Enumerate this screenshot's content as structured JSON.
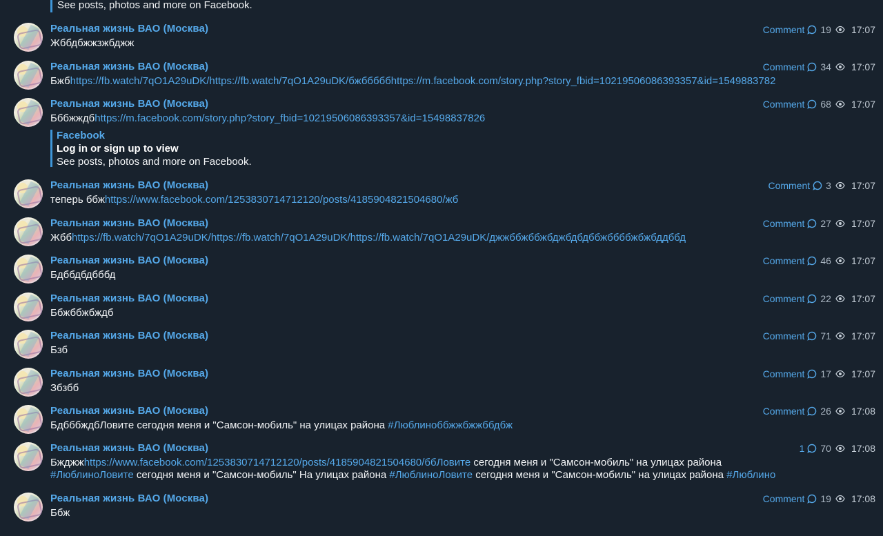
{
  "top_quote": {
    "body": "See posts, photos and more on Facebook."
  },
  "channel_name": "Реальная жизнь ВАО (Москва)",
  "messages": [
    {
      "comment": "Comment",
      "views": "19",
      "time": "17:07",
      "text": "Жббдбжжзжбджж"
    },
    {
      "comment": "Comment",
      "views": "34",
      "time": "17:07",
      "text": "Бжб",
      "link": "https://fb.watch/7qO1A29uDK/https://fb.watch/7qO1A29uDK/бжбббббhttps://m.facebook.com/story.php?story_fbid=10219506086393357&id=1549883782"
    },
    {
      "comment": "Comment",
      "views": "68",
      "time": "17:07",
      "text": "Ббб​жждб",
      "link": "https://m.facebook.com/story.php?story_fbid=10219506086393357&id=15498837826",
      "preview": {
        "site": "Facebook",
        "title": "Log in or sign up to view",
        "body": "See posts, photos and more on Facebook."
      }
    },
    {
      "comment": "Comment",
      "views": "3",
      "time": "17:07",
      "text": "теперь ббж",
      "link": "https://www.facebook.com/1253830714712120/posts/4185904821504680/жб"
    },
    {
      "comment": "Comment",
      "views": "27",
      "time": "17:07",
      "text": "Жбб",
      "link": "https://fb.watch/7qO1A29uDK/https://fb.watch/7qO1A29uDK/https://fb.watch/7qO1A29uDK/джжббжббжбджбдбдббжббббжбжбддббд"
    },
    {
      "comment": "Comment",
      "views": "46",
      "time": "17:07",
      "text": "Бдббдбдбббд"
    },
    {
      "comment": "Comment",
      "views": "22",
      "time": "17:07",
      "text": "Ббжббжбждб"
    },
    {
      "comment": "Comment",
      "views": "71",
      "time": "17:07",
      "text": "Бзб"
    },
    {
      "comment": "Comment",
      "views": "17",
      "time": "17:07",
      "text": "Збзбб"
    },
    {
      "comment": "Comment",
      "views": "26",
      "time": "17:08",
      "text": "БдбббждбЛовите сегодня меня и \"Самсон-мобиль\" на улицах района ",
      "link": "#Люблиноббжжбжжббдбж"
    },
    {
      "comment": "1",
      "views": "70",
      "time": "17:08",
      "text": "Бжджж",
      "link": "https://www.facebook.com/1253830714712120/posts/4185904821504680/ббЛовите",
      "text_after": " сегодня меня и \"Самсон-мобиль\" на улицах района",
      "line2": [
        {
          "t": "#ЛюблиноЛовите",
          "link": true
        },
        {
          "t": " сегодня меня и \"Самсон-мобиль\" На улицах района ",
          "link": false
        },
        {
          "t": "#ЛюблиноЛовите",
          "link": true
        },
        {
          "t": " сегодня меня и \"Самсон-мобиль\" на улицах района ",
          "link": false
        },
        {
          "t": "#Люблино",
          "link": true
        }
      ]
    },
    {
      "comment": "Comment",
      "views": "19",
      "time": "17:08",
      "text": "Ббж"
    }
  ],
  "colors": {
    "background": "#18222d",
    "link": "#55a9ea",
    "accent_bar": "#3f96d8",
    "meta": "#9aa8b5"
  }
}
